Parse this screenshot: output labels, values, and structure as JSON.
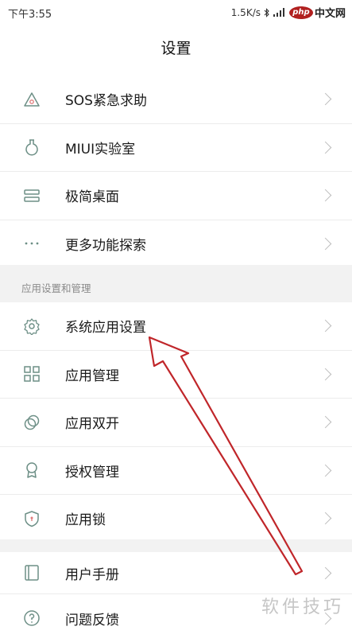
{
  "status": {
    "time": "下午3:55",
    "speed": "1.5K/s",
    "logo": "php",
    "logo_text": "中文网"
  },
  "title": "设置",
  "group1": [
    {
      "label": "SOS紧急求助",
      "icon": "sos-icon"
    },
    {
      "label": "MIUI实验室",
      "icon": "lab-flask-icon"
    },
    {
      "label": "极简桌面",
      "icon": "minimal-desktop-icon"
    },
    {
      "label": "更多功能探索",
      "icon": "more-dots-icon"
    }
  ],
  "section_header": "应用设置和管理",
  "group2": [
    {
      "label": "系统应用设置",
      "icon": "gear-icon"
    },
    {
      "label": "应用管理",
      "icon": "app-grid-icon"
    },
    {
      "label": "应用双开",
      "icon": "dual-app-icon"
    },
    {
      "label": "授权管理",
      "icon": "authorization-badge-icon"
    },
    {
      "label": "应用锁",
      "icon": "app-lock-shield-icon"
    }
  ],
  "group3": [
    {
      "label": "用户手册",
      "icon": "user-manual-icon"
    },
    {
      "label": "问题反馈",
      "icon": "feedback-question-icon"
    }
  ],
  "watermark": "软件技巧",
  "colors": {
    "icon_stroke": "#6d8f86",
    "annotation_arrow": "#c0262a",
    "section_bg": "#f2f2f2"
  }
}
